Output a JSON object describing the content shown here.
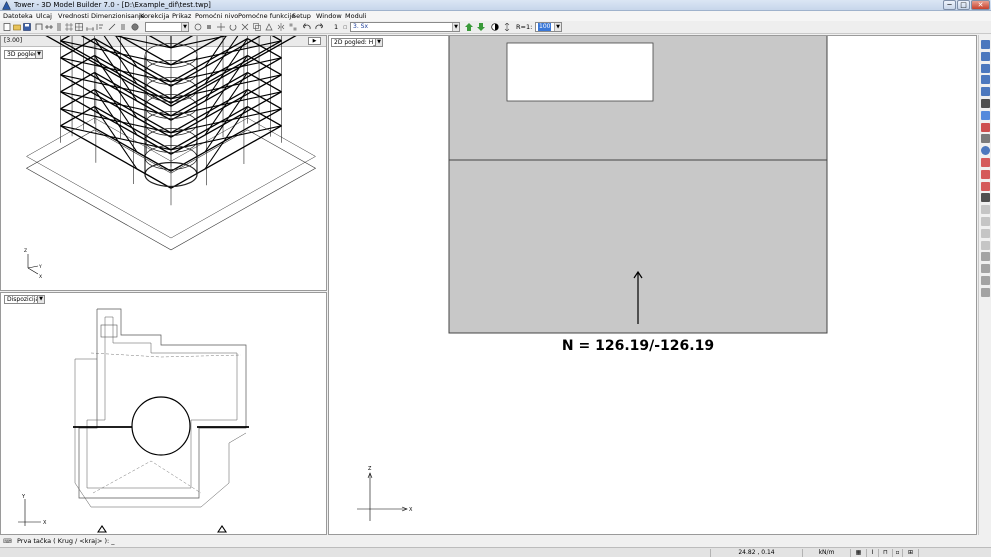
{
  "window": {
    "title": "Tower - 3D Model Builder 7.0 - [D:\\Example_dif\\test.twp]",
    "min_label": "─",
    "max_label": "□",
    "close_label": "✕"
  },
  "menu": [
    "Datoteka",
    "Ulcaj",
    "Vrednosti",
    "Dimenzionisanje",
    "Korekcija",
    "Prikaz",
    "Pomoćni nivo",
    "Pomoćne funkcije",
    "Setup",
    "Window",
    "Moduli"
  ],
  "toolbar": {
    "layer_combo_value": "",
    "step_label": "1",
    "load_case_value": "3. Sx",
    "r_label": "R=1:",
    "r_value": "100"
  },
  "panels": {
    "view3d": {
      "level": "[3.00]",
      "view_mode": "3D pogled",
      "axis_x": "X",
      "axis_y": "Y",
      "axis_z": "Z"
    },
    "disposition": {
      "view_mode": "Dispozicija",
      "axis_x": "X",
      "axis_y": "Y"
    },
    "view2d": {
      "view_mode": "2D pogled: H_4",
      "force_label": "N = 126.19/-126.19",
      "axis_x": "X",
      "axis_z": "Z"
    }
  },
  "command_line": {
    "prompt": "Prva tačka ( Krug / <kraj> ): _"
  },
  "status": {
    "coords": "24.82 , 0.14",
    "units": "kN/m"
  },
  "colors": {
    "wall_fill": "#c8c8c8",
    "accent_selection": "#3a78d8"
  }
}
